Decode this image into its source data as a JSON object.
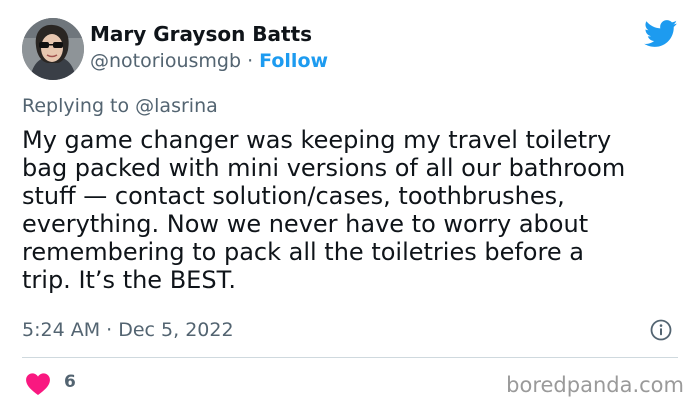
{
  "author": {
    "display_name": "Mary Grayson Batts",
    "handle": "@notoriousmgb",
    "separator": " · ",
    "follow_label": "Follow"
  },
  "reply": {
    "prefix": "Replying to ",
    "mention": "@lasrina"
  },
  "tweet": {
    "text_lines": [
      "My game changer was keeping my travel toiletry",
      "bag packed with mini versions of all our bathroom",
      "stuff — contact solution/cases, toothbrushes,",
      "everything. Now we never have to worry about",
      "remembering to pack all the toiletries before a",
      "trip. It’s the BEST."
    ],
    "timestamp": "5:24 AM · Dec 5, 2022",
    "like_count": "6"
  },
  "watermark": "boredpanda.com",
  "icons": {
    "logo": "twitter-bird-icon",
    "info": "info-icon",
    "like": "heart-icon"
  },
  "colors": {
    "accent": "#1d9bf0",
    "like": "#f91880",
    "text": "#0f1419",
    "muted": "#536471"
  }
}
